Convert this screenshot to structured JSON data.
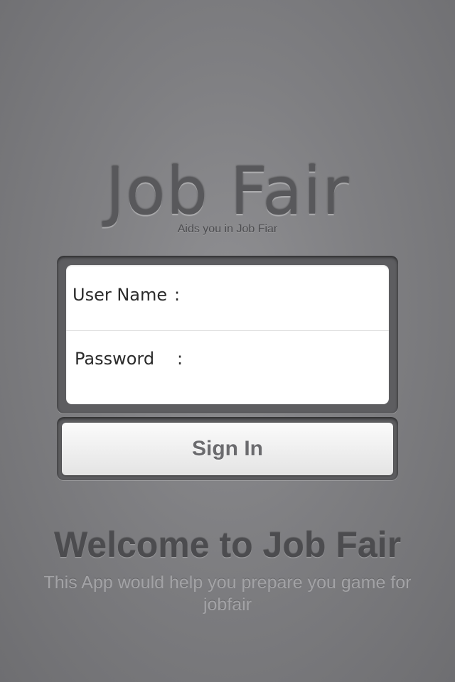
{
  "app": {
    "title": "Job Fair",
    "tagline": "Aids you in Job Fiar"
  },
  "login": {
    "username_label": "User Name",
    "username_value": "",
    "password_label": "Password",
    "password_value": "",
    "separator": ":",
    "sign_in_label": "Sign In"
  },
  "welcome": {
    "title": "Welcome to Job Fair",
    "description": "This App would help you prepare you game for jobfair"
  }
}
